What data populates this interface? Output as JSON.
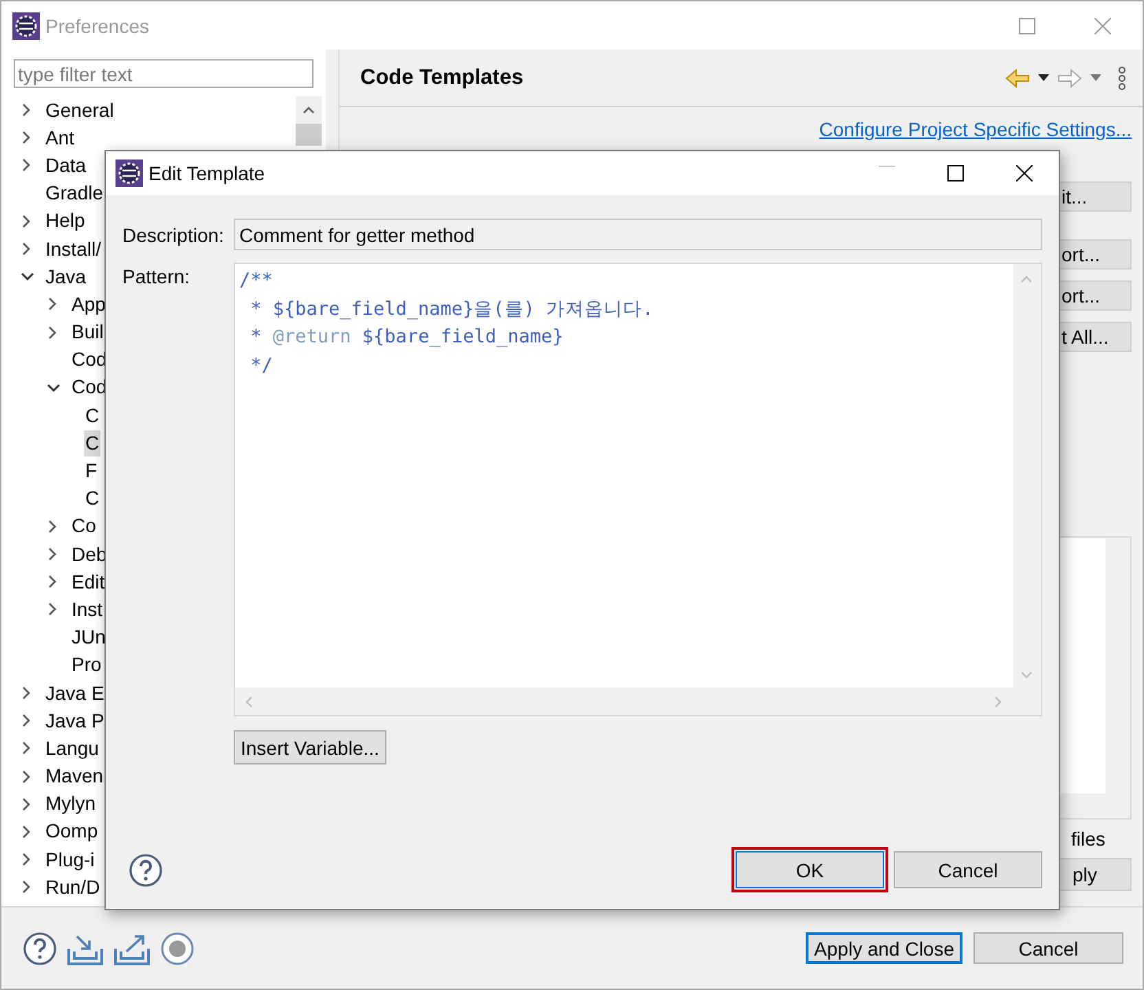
{
  "window": {
    "title": "Preferences"
  },
  "filter": {
    "placeholder": "type filter text"
  },
  "tree": [
    {
      "label": "General",
      "kind": "branch",
      "expanded": false,
      "selected": false
    },
    {
      "label": "Ant",
      "kind": "branch",
      "expanded": false,
      "selected": false
    },
    {
      "label": "Data",
      "kind": "branch",
      "expanded": false,
      "selected": false
    },
    {
      "label": "Gradle",
      "kind": "leaf",
      "selected": false
    },
    {
      "label": "Help",
      "kind": "branch",
      "expanded": false,
      "selected": false
    },
    {
      "label": "Install/",
      "kind": "branch",
      "expanded": false,
      "selected": false
    },
    {
      "label": "Java",
      "kind": "branch",
      "expanded": true,
      "selected": false,
      "children": [
        {
          "label": "App",
          "kind": "branch",
          "expanded": false,
          "selected": false
        },
        {
          "label": "Buil",
          "kind": "branch",
          "expanded": false,
          "selected": false
        },
        {
          "label": "Cod",
          "kind": "leaf",
          "selected": false
        },
        {
          "label": "Cod",
          "kind": "branch",
          "expanded": true,
          "selected": false,
          "children": [
            {
              "label": "C",
              "kind": "leaf",
              "selected": false
            },
            {
              "label": "C",
              "kind": "leaf",
              "selected": true
            },
            {
              "label": "F",
              "kind": "leaf",
              "selected": false
            },
            {
              "label": "C",
              "kind": "leaf",
              "selected": false
            }
          ]
        },
        {
          "label": "Co",
          "kind": "branch",
          "expanded": false,
          "selected": false
        },
        {
          "label": "Deb",
          "kind": "branch",
          "expanded": false,
          "selected": false
        },
        {
          "label": "Edit",
          "kind": "branch",
          "expanded": false,
          "selected": false
        },
        {
          "label": "Inst",
          "kind": "branch",
          "expanded": false,
          "selected": false
        },
        {
          "label": "JUn",
          "kind": "leaf",
          "selected": false
        },
        {
          "label": "Pro",
          "kind": "leaf",
          "selected": false
        }
      ]
    },
    {
      "label": "Java E",
      "kind": "branch",
      "expanded": false,
      "selected": false
    },
    {
      "label": "Java P",
      "kind": "branch",
      "expanded": false,
      "selected": false
    },
    {
      "label": "Langu",
      "kind": "branch",
      "expanded": false,
      "selected": false
    },
    {
      "label": "Maven",
      "kind": "branch",
      "expanded": false,
      "selected": false
    },
    {
      "label": "Mylyn",
      "kind": "branch",
      "expanded": false,
      "selected": false
    },
    {
      "label": "Oomp",
      "kind": "branch",
      "expanded": false,
      "selected": false
    },
    {
      "label": "Plug-i",
      "kind": "branch",
      "expanded": false,
      "selected": false
    },
    {
      "label": "Run/D",
      "kind": "branch",
      "expanded": false,
      "selected": false
    }
  ],
  "page": {
    "title": "Code Templates",
    "link": "Configure Project Specific Settings...",
    "side_buttons": [
      "it...",
      "ort...",
      "ort...",
      "t All..."
    ],
    "files_label": "files",
    "apply_button": "ply"
  },
  "footer": {
    "buttons": [
      {
        "label": "Apply and Close",
        "focused": true
      },
      {
        "label": "Cancel",
        "focused": false
      }
    ]
  },
  "dialog": {
    "title": "Edit Template",
    "description_label": "Description:",
    "description": "Comment for getter method",
    "pattern_label": "Pattern:",
    "pattern_lines": [
      [
        {
          "text": "/**",
          "kind": "text"
        }
      ],
      [
        {
          "text": " * ${bare_field_name}을(를) 가져옵니다.",
          "kind": "text"
        }
      ],
      [
        {
          "text": " * ",
          "kind": "text"
        },
        {
          "text": "@return",
          "kind": "tag"
        },
        {
          "text": " ${bare_field_name}",
          "kind": "text"
        }
      ],
      [
        {
          "text": " */",
          "kind": "text"
        }
      ]
    ],
    "insert_button": "Insert Variable...",
    "buttons": [
      {
        "label": "OK",
        "highlighted": true
      },
      {
        "label": "Cancel",
        "highlighted": false
      }
    ]
  }
}
